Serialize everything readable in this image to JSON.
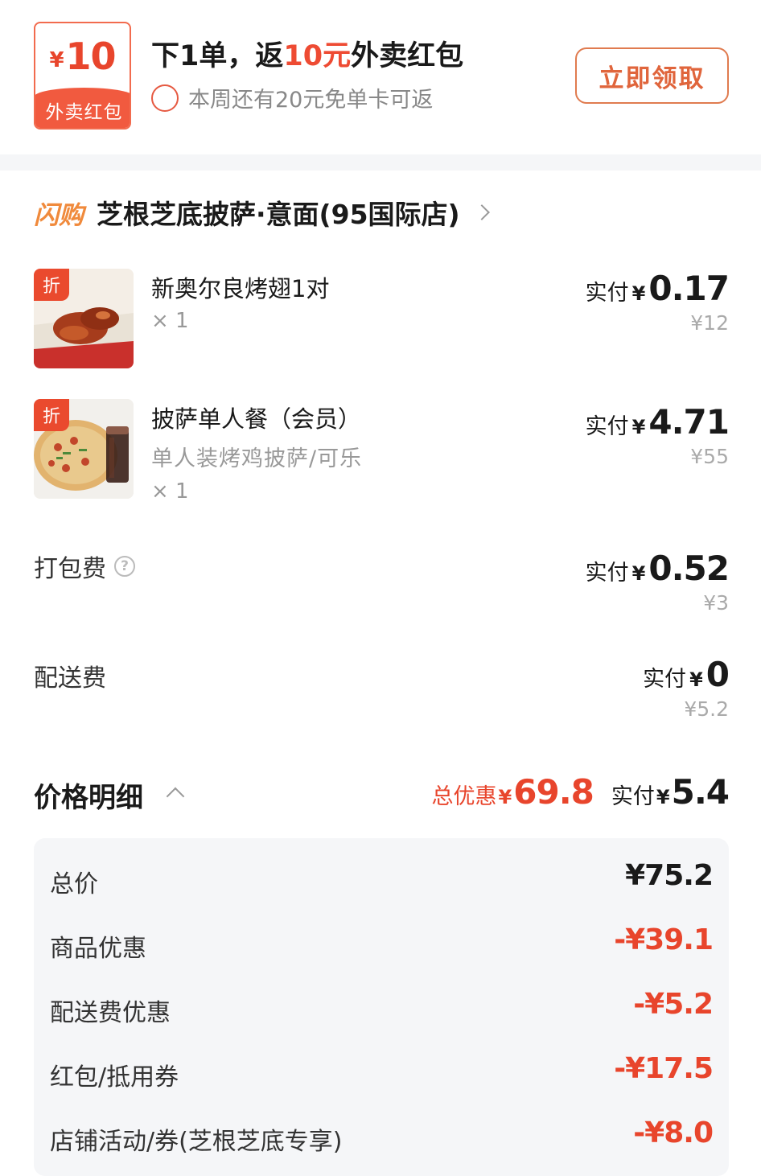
{
  "banner": {
    "coupon_currency": "¥",
    "coupon_amount": "10",
    "coupon_label": "外卖红包",
    "title_prefix": "下1单，返",
    "title_highlight": "10元",
    "title_suffix": "外卖红包",
    "subtitle": "本周还有20元免单卡可返",
    "claim_button": "立即领取"
  },
  "store": {
    "tag": "闪购",
    "name": "芝根芝底披萨·意面(95国际店)"
  },
  "items": [
    {
      "badge": "折",
      "name": "新奥尔良烤翅1对",
      "spec": "",
      "qty": "× 1",
      "pay_label": "实付",
      "currency": "¥",
      "pay_amount": "0.17",
      "original": "¥12",
      "thumb_icon": "chicken-wings-image"
    },
    {
      "badge": "折",
      "name": "披萨单人餐（会员）",
      "spec": "单人装烤鸡披萨/可乐",
      "qty": "× 1",
      "pay_label": "实付",
      "currency": "¥",
      "pay_amount": "4.71",
      "original": "¥55",
      "thumb_icon": "pizza-cola-image"
    }
  ],
  "fees": [
    {
      "label": "打包费",
      "has_help": true,
      "help_icon": "question-circle-icon",
      "pay_label": "实付",
      "currency": "¥",
      "pay_amount": "0.52",
      "original": "¥3"
    },
    {
      "label": "配送费",
      "has_help": false,
      "pay_label": "实付",
      "currency": "¥",
      "pay_amount": "0",
      "original": "¥5.2"
    }
  ],
  "summary": {
    "title": "价格明细",
    "discount_label": "总优惠",
    "discount_currency": "¥",
    "discount_amount": "69.8",
    "pay_label": "实付",
    "pay_currency": "¥",
    "pay_amount": "5.4"
  },
  "details": [
    {
      "label": "总价",
      "value": "¥75.2",
      "type": "pos"
    },
    {
      "label": "商品优惠",
      "value": "-¥39.1",
      "type": "neg"
    },
    {
      "label": "配送费优惠",
      "value": "-¥5.2",
      "type": "neg"
    },
    {
      "label": "红包/抵用券",
      "value": "-¥17.5",
      "type": "neg"
    },
    {
      "label": "店铺活动/券(芝根芝底专享)",
      "value": "-¥8.0",
      "type": "neg"
    }
  ],
  "colors": {
    "accent_red": "#e8452c",
    "accent_orange": "#e0653c",
    "flash_orange": "#f08a3c",
    "panel_bg": "#f5f6f8"
  }
}
